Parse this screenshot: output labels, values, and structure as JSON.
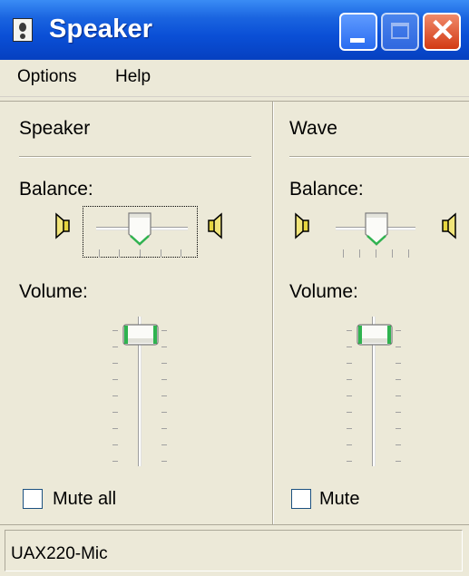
{
  "window": {
    "title": "Speaker"
  },
  "menu": {
    "options_label": "Options",
    "help_label": "Help"
  },
  "columns": [
    {
      "title": "Speaker",
      "balance_label": "Balance:",
      "volume_label": "Volume:",
      "mute_label": "Mute all",
      "mute_checked": false
    },
    {
      "title": "Wave",
      "balance_label": "Balance:",
      "volume_label": "Volume:",
      "mute_label": "Mute",
      "mute_checked": false
    }
  ],
  "status": {
    "text": "UAX220-Mic"
  },
  "colors": {
    "titlebar": "#0a4fd6",
    "thumb_accent": "#2fb34f",
    "speaker_icon": "#e6d640"
  }
}
